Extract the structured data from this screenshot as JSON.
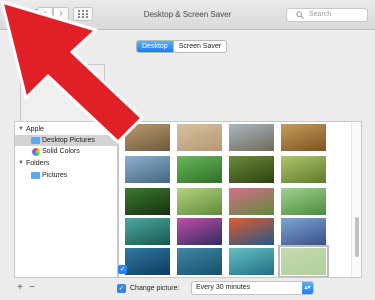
{
  "window": {
    "title": "Desktop & Screen Saver"
  },
  "search": {
    "placeholder": "Search"
  },
  "nav": {
    "back": "‹",
    "forward": "›"
  },
  "tabs": [
    {
      "label": "Desktop",
      "selected": true
    },
    {
      "label": "Screen Saver",
      "selected": false
    }
  ],
  "sidebar": {
    "groups": [
      {
        "label": "Apple",
        "expanded": true,
        "items": [
          {
            "label": "Desktop Pictures",
            "icon": "folder-icon",
            "selected": true
          },
          {
            "label": "Solid Colors",
            "icon": "color-wheel-icon",
            "selected": false
          }
        ]
      },
      {
        "label": "Folders",
        "expanded": true,
        "items": [
          {
            "label": "Pictures",
            "icon": "folder-icon",
            "selected": false
          }
        ]
      }
    ]
  },
  "thumbnails": [
    {
      "name": "beach-dunes",
      "colors": [
        "#b99a6b",
        "#6f5a3f"
      ]
    },
    {
      "name": "desert-sand",
      "colors": [
        "#d8c2a1",
        "#b79672"
      ]
    },
    {
      "name": "elephants-savanna",
      "colors": [
        "#aab8c4",
        "#6f6a55"
      ]
    },
    {
      "name": "lion-closeup",
      "colors": [
        "#c99c5b",
        "#7a5322"
      ]
    },
    {
      "name": "birds-over-water",
      "colors": [
        "#8db0cf",
        "#45667f"
      ]
    },
    {
      "name": "wet-grass",
      "colors": [
        "#6ab85a",
        "#2f6d2a"
      ]
    },
    {
      "name": "marsh-plants",
      "colors": [
        "#6a8d39",
        "#2c3f12"
      ]
    },
    {
      "name": "mossy-field",
      "colors": [
        "#b1c66a",
        "#5d7a2d"
      ]
    },
    {
      "name": "seedling-sprout",
      "colors": [
        "#3e7a2e",
        "#14300f"
      ]
    },
    {
      "name": "green-bokeh",
      "colors": [
        "#b3d47b",
        "#5f8a3e"
      ]
    },
    {
      "name": "pink-flower-field",
      "colors": [
        "#d86d8a",
        "#5d8a3a"
      ]
    },
    {
      "name": "green-leaf",
      "colors": [
        "#9ed48e",
        "#4d8a3e"
      ]
    },
    {
      "name": "teal-leaves",
      "colors": [
        "#4ba9a0",
        "#18584e"
      ]
    },
    {
      "name": "pink-lotus",
      "colors": [
        "#c44da6",
        "#2d2c63"
      ]
    },
    {
      "name": "coral-reef",
      "colors": [
        "#e45a2a",
        "#1e5a8a"
      ]
    },
    {
      "name": "lavender-wave",
      "colors": [
        "#7aa7d3",
        "#3b4f8a"
      ]
    },
    {
      "name": "blue-water",
      "colors": [
        "#2f79a3",
        "#0f3a5c"
      ]
    },
    {
      "name": "deep-ocean",
      "colors": [
        "#3f88a6",
        "#174f6c"
      ]
    },
    {
      "name": "turquoise-surf",
      "colors": [
        "#66c0c2",
        "#1f6f88"
      ]
    },
    {
      "name": "pale-green",
      "colors": [
        "#c3dbb1",
        "#b1cf9b"
      ],
      "selected": true
    }
  ],
  "bottom": {
    "plus": "+",
    "minus": "−",
    "change_picture_label": "Change picture:",
    "change_picture_checked": true,
    "interval": "Every 30 minutes",
    "checkmark": "✓",
    "arrow": "▴▾"
  },
  "colors": {
    "accent": "#1c7cf2",
    "annotation_arrow": "#e01f26"
  }
}
